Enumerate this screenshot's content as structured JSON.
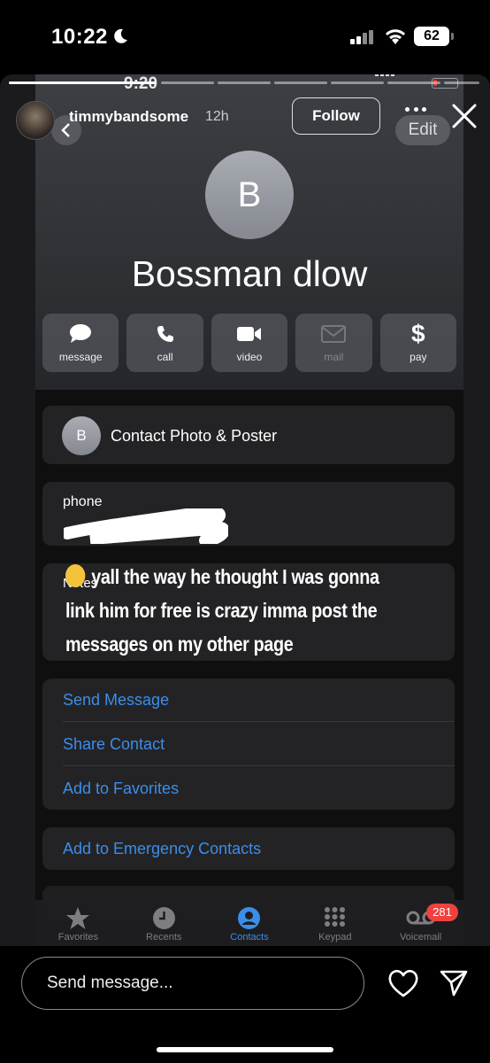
{
  "status_bar": {
    "time": "10:22",
    "battery": "62"
  },
  "story": {
    "inner_time": "9:20",
    "username": "timmybandsome",
    "age": "12h",
    "follow_label": "Follow",
    "edit_label": "Edit"
  },
  "contact": {
    "initial": "B",
    "name": "Bossman dlow",
    "actions": [
      {
        "label": "message",
        "icon": "message-bubble-icon"
      },
      {
        "label": "call",
        "icon": "phone-icon"
      },
      {
        "label": "video",
        "icon": "video-camera-icon"
      },
      {
        "label": "mail",
        "icon": "mail-icon"
      },
      {
        "label": "pay",
        "icon": "dollar-icon"
      }
    ],
    "photo_row": "Contact Photo & Poster",
    "phone_label": "phone",
    "notes_label": "Notes",
    "links": [
      "Send Message",
      "Share Contact",
      "Add to Favorites"
    ],
    "emergency": "Add to Emergency Contacts"
  },
  "caption": "yall the way he thought I was gonna link him for free is crazy imma post the messages on my other page",
  "tabbar": {
    "tabs": [
      {
        "label": "Favorites",
        "icon": "star-icon"
      },
      {
        "label": "Recents",
        "icon": "clock-icon"
      },
      {
        "label": "Contacts",
        "icon": "person-icon",
        "active": true
      },
      {
        "label": "Keypad",
        "icon": "keypad-icon"
      },
      {
        "label": "Voicemail",
        "icon": "voicemail-icon"
      }
    ],
    "voicemail_badge": "281"
  },
  "composer": {
    "placeholder": "Send message..."
  },
  "colors": {
    "link": "#3b8eea",
    "badge": "#f04040",
    "background": "#000000"
  }
}
